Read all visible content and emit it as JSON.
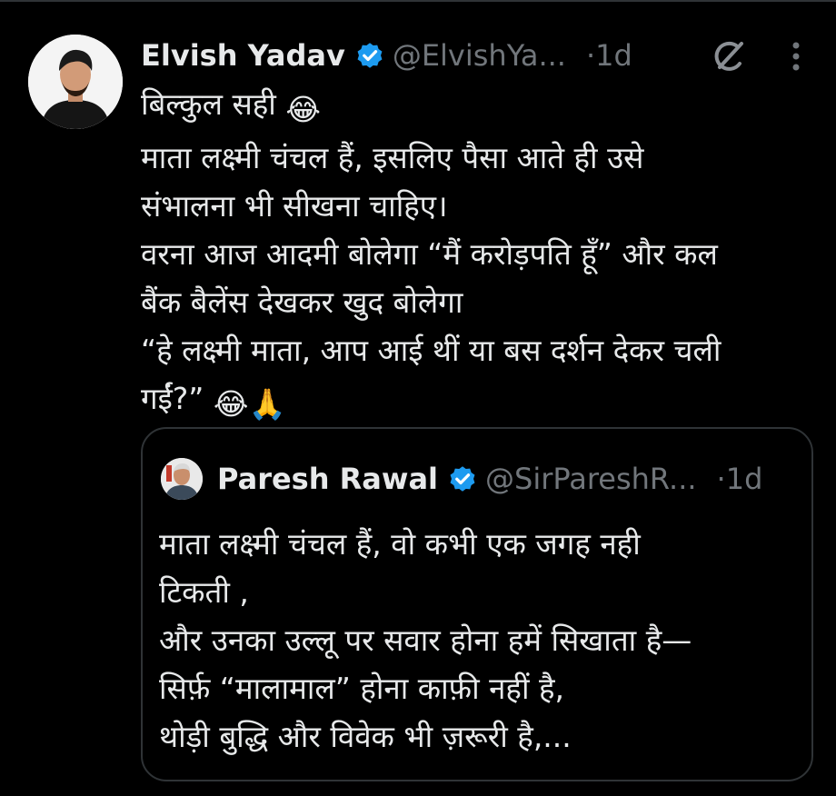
{
  "tweet": {
    "author": {
      "name": "Elvish Yadav",
      "handle": "@ElvishYa...",
      "verified": true
    },
    "time_separator": "·",
    "time": "1d",
    "lines": [
      "बिल्कुल सही",
      "माता लक्ष्मी चंचल हैं, इसलिए पैसा आते ही उसे",
      "संभालना भी सीखना चाहिए।",
      "वरना आज आदमी बोलेगा “मैं करोड़पति हूँ” और कल",
      "बैंक बैलेंस देखकर खुद बोलेगा",
      "“हे लक्ष्मी माता, आप आई थीं या बस दर्शन देकर चली",
      "गईं?”"
    ],
    "emojis": [
      "😂",
      "😂",
      "🙏"
    ]
  },
  "quote": {
    "author": {
      "name": "Paresh Rawal",
      "handle": "@SirPareshR...",
      "verified": true
    },
    "time_separator": "·",
    "time": "1d",
    "lines": [
      "माता लक्ष्मी चंचल हैं, वो कभी एक जगह नही",
      "टिकती ,",
      "और उनका उल्लू पर सवार होना हमें सिखाता है—",
      "सिर्फ़ “मालामाल” होना काफ़ी नहीं है,",
      "थोड़ी बुद्धि और विवेक भी ज़रूरी है,..."
    ]
  },
  "icons": {
    "grok": "grok-icon",
    "more": "more-options-icon",
    "verified": "verified-badge-icon"
  },
  "colors": {
    "background": "#000000",
    "text": "#e7e9ea",
    "secondary": "#71767b",
    "border": "#2f3336",
    "verified": "#1d9bf0"
  }
}
